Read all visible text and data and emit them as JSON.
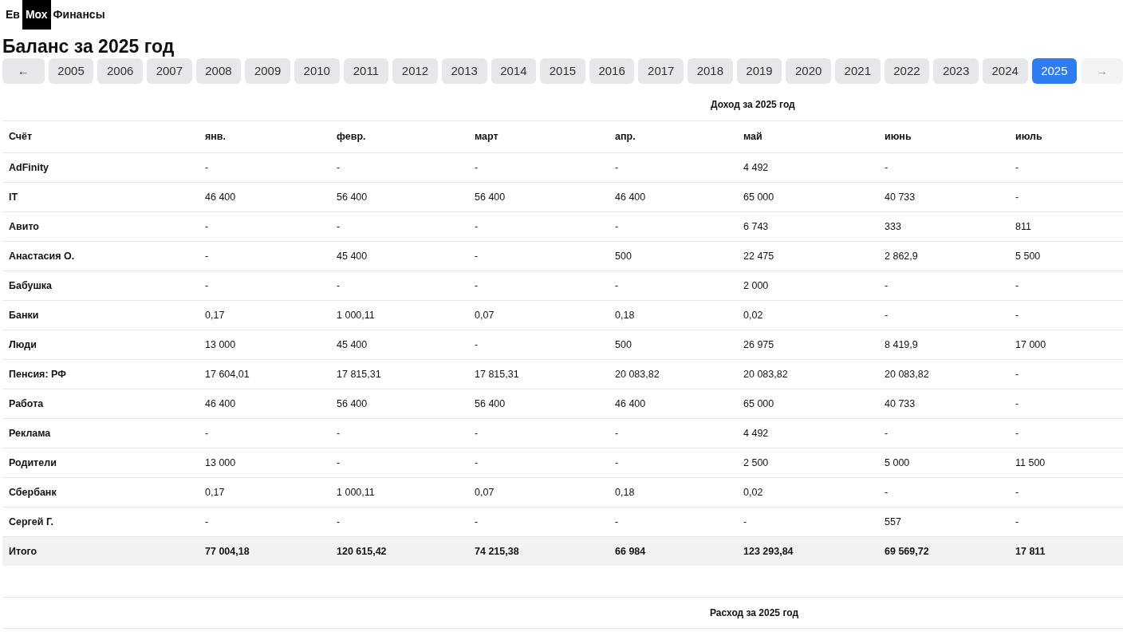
{
  "logo": {
    "parts": [
      "Ев",
      "Мох",
      "Финансы"
    ]
  },
  "title": "Баланс за 2025 год",
  "year_nav": {
    "prev": {
      "label": "←",
      "disabled": false
    },
    "years": [
      {
        "label": "2005",
        "selected": false
      },
      {
        "label": "2006",
        "selected": false
      },
      {
        "label": "2007",
        "selected": false
      },
      {
        "label": "2008",
        "selected": false
      },
      {
        "label": "2009",
        "selected": false
      },
      {
        "label": "2010",
        "selected": false
      },
      {
        "label": "2011",
        "selected": false
      },
      {
        "label": "2012",
        "selected": false
      },
      {
        "label": "2013",
        "selected": false
      },
      {
        "label": "2014",
        "selected": false
      },
      {
        "label": "2015",
        "selected": false
      },
      {
        "label": "2016",
        "selected": false
      },
      {
        "label": "2017",
        "selected": false
      },
      {
        "label": "2018",
        "selected": false
      },
      {
        "label": "2019",
        "selected": false
      },
      {
        "label": "2020",
        "selected": false
      },
      {
        "label": "2021",
        "selected": false
      },
      {
        "label": "2022",
        "selected": false
      },
      {
        "label": "2023",
        "selected": false
      },
      {
        "label": "2024",
        "selected": false
      },
      {
        "label": "2025",
        "selected": true
      }
    ],
    "next": {
      "label": "→",
      "disabled": true
    }
  },
  "income_table": {
    "caption": "Доход за 2025 год",
    "columns": [
      "Счёт",
      "янв.",
      "февр.",
      "март",
      "апр.",
      "май",
      "июнь",
      "июль"
    ],
    "rows": [
      [
        "AdFinity",
        "-",
        "-",
        "-",
        "-",
        "4 492",
        "-",
        "-"
      ],
      [
        "IT",
        "46 400",
        "56 400",
        "56 400",
        "46 400",
        "65 000",
        "40 733",
        "-"
      ],
      [
        "Авито",
        "-",
        "-",
        "-",
        "-",
        "6 743",
        "333",
        "811"
      ],
      [
        "Анастасия О.",
        "-",
        "45 400",
        "-",
        "500",
        "22 475",
        "2 862,9",
        "5 500"
      ],
      [
        "Бабушка",
        "-",
        "-",
        "-",
        "-",
        "2 000",
        "-",
        "-"
      ],
      [
        "Банки",
        "0,17",
        "1 000,11",
        "0,07",
        "0,18",
        "0,02",
        "-",
        "-"
      ],
      [
        "Люди",
        "13 000",
        "45 400",
        "-",
        "500",
        "26 975",
        "8 419,9",
        "17 000"
      ],
      [
        "Пенсия: РФ",
        "17 604,01",
        "17 815,31",
        "17 815,31",
        "20 083,82",
        "20 083,82",
        "20 083,82",
        "-"
      ],
      [
        "Работа",
        "46 400",
        "56 400",
        "56 400",
        "46 400",
        "65 000",
        "40 733",
        "-"
      ],
      [
        "Реклама",
        "-",
        "-",
        "-",
        "-",
        "4 492",
        "-",
        "-"
      ],
      [
        "Родители",
        "13 000",
        "-",
        "-",
        "-",
        "2 500",
        "5 000",
        "11 500"
      ],
      [
        "Сбербанк",
        "0,17",
        "1 000,11",
        "0,07",
        "0,18",
        "0,02",
        "-",
        "-"
      ],
      [
        "Сергей Г.",
        "-",
        "-",
        "-",
        "-",
        "-",
        "557",
        "-"
      ]
    ],
    "total": [
      "Итого",
      "77 004,18",
      "120 615,42",
      "74 215,38",
      "66 984",
      "123 293,84",
      "69 569,72",
      "17 811"
    ]
  },
  "expense_table": {
    "caption": "Расход за 2025 год"
  }
}
